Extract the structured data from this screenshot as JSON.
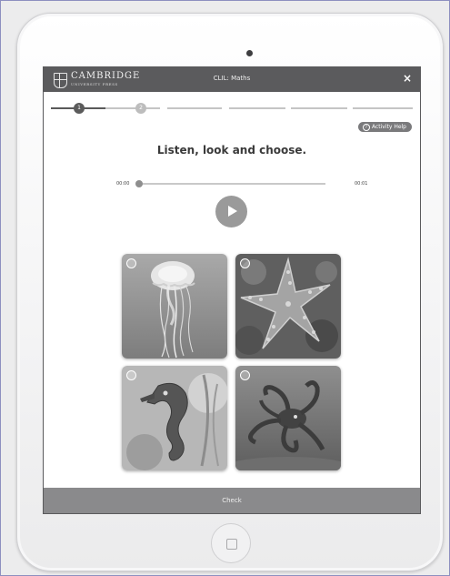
{
  "app": {
    "brand": "CAMBRIDGE",
    "brand_sub": "UNIVERSITY PRESS",
    "course_title": "CLIL: Maths",
    "close_label": "×"
  },
  "progress": {
    "steps": [
      {
        "label": "1",
        "state": "current"
      },
      {
        "label": "2",
        "state": "upcoming"
      }
    ]
  },
  "activity": {
    "help_label": "Activity Help",
    "help_icon_glyph": "?",
    "instruction": "Listen, look and choose.",
    "audio": {
      "start_time": "00:00",
      "end_time": "00:01",
      "position_fraction": 0
    },
    "options": [
      {
        "icon": "jellyfish-image"
      },
      {
        "icon": "starfish-image"
      },
      {
        "icon": "seahorse-image"
      },
      {
        "icon": "octopus-image"
      }
    ],
    "check_label": "Check"
  },
  "colors": {
    "header": "#5b5b5d",
    "check_bar": "#8a8a8c",
    "play_button": "#9a9a9a"
  }
}
